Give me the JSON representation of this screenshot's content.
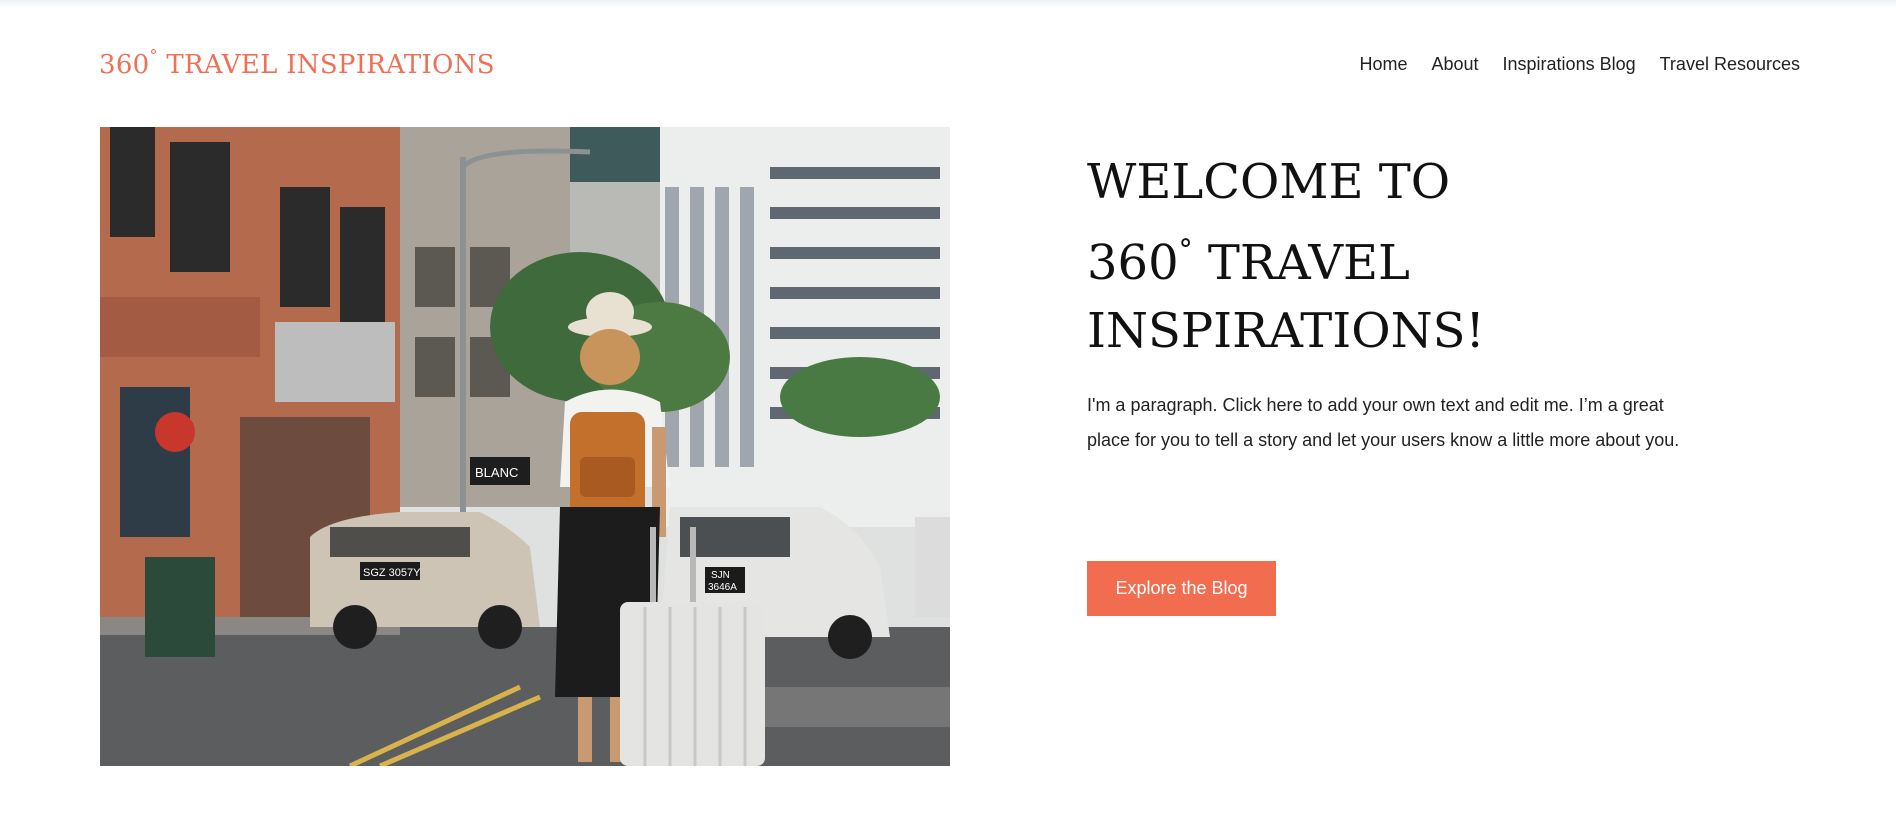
{
  "header": {
    "logo_prefix": "360",
    "logo_degree": "°",
    "logo_rest": " TRAVEL INSPIRATIONS",
    "nav": [
      {
        "label": "Home"
      },
      {
        "label": "About"
      },
      {
        "label": "Inspirations Blog"
      },
      {
        "label": "Travel Resources"
      }
    ]
  },
  "hero": {
    "headline_line1": "WELCOME TO",
    "headline_line2_prefix": "360",
    "headline_degree": "°",
    "headline_line2_rest": " TRAVEL",
    "headline_line3": "INSPIRATIONS!",
    "paragraph": "I'm a paragraph. Click here to add your own text and edit me. I’m a great place for you to tell a story and let your users know a little more about you.",
    "button_label": "Explore the Blog",
    "image": {
      "sign_text": "BLANC",
      "plate_left": "SGZ 3057Y",
      "plate_right_line1": "SJN",
      "plate_right_line2": "3646A"
    }
  },
  "colors": {
    "accent": "#ee7057",
    "button": "#f26c4f",
    "text": "#111111"
  }
}
